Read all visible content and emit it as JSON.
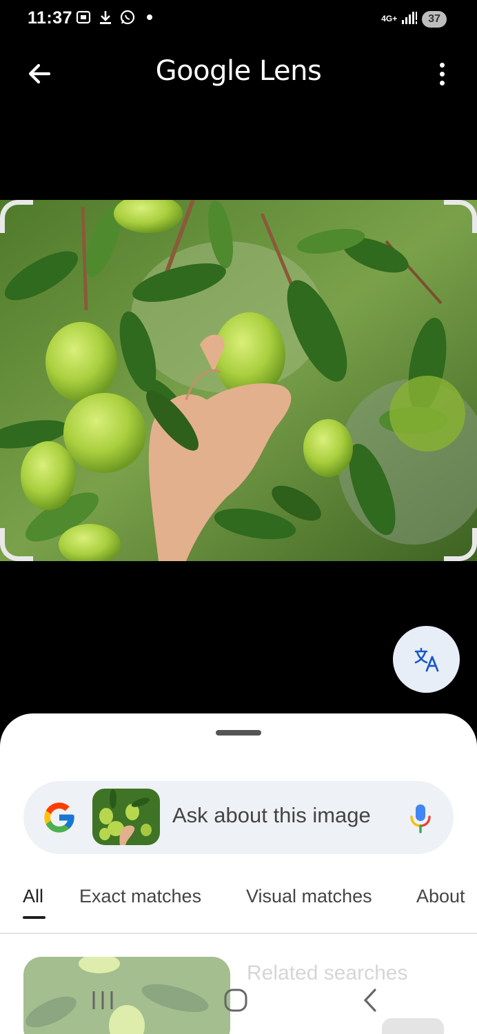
{
  "status_bar": {
    "time": "11:37",
    "network": "4G+",
    "battery": "37",
    "icons": [
      "screenshot-icon",
      "download-icon",
      "whatsapp-icon",
      "dot-icon",
      "signal-icon"
    ]
  },
  "app_bar": {
    "title": "Google Lens",
    "back_icon": "arrow-back-icon",
    "more_icon": "more-vert-icon"
  },
  "image": {
    "subject_icon": "pear-tree-photo"
  },
  "translate_button": {
    "icon": "translate-icon"
  },
  "search": {
    "placeholder": "Ask about this image",
    "logo": "google-g-logo",
    "mic_icon": "mic-icon"
  },
  "tabs": [
    {
      "label": "All",
      "selected": true
    },
    {
      "label": "Exact matches",
      "selected": false
    },
    {
      "label": "Visual matches",
      "selected": false
    },
    {
      "label": "About",
      "selected": false
    }
  ],
  "results": {
    "related_title": "Related searches"
  },
  "nav": {
    "recent_icon": "recent-apps-icon",
    "home_icon": "home-icon",
    "back_icon": "nav-back-icon"
  },
  "colors": {
    "background": "#000000",
    "sheet": "#ffffff",
    "search_bar": "#eef1f5",
    "translate_fab": "#e8eef7",
    "accent_blue": "#1a73e8"
  }
}
